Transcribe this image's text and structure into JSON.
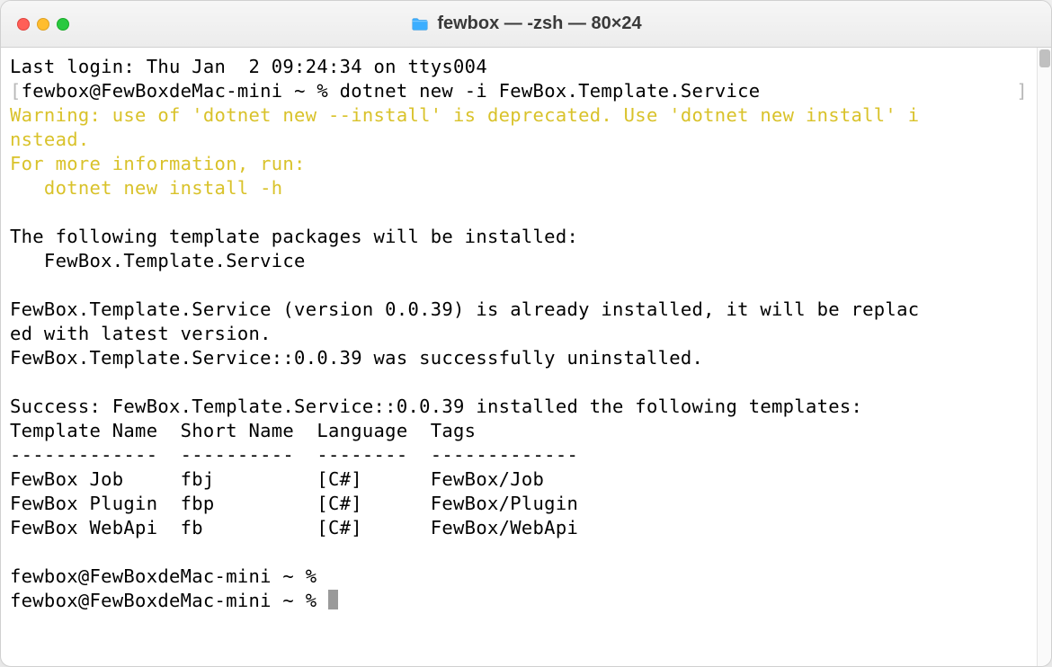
{
  "window": {
    "title": "fewbox — -zsh — 80×24"
  },
  "terminal": {
    "last_login": "Last login: Thu Jan  2 09:24:34 on ttys004",
    "prompt_open": "[",
    "prompt_text": "fewbox@FewBoxdeMac-mini ~ % ",
    "prompt_close": "]",
    "command": "dotnet new -i FewBox.Template.Service",
    "warning_line1": "Warning: use of 'dotnet new --install' is deprecated. Use 'dotnet new install' i",
    "warning_line2": "nstead.",
    "warning_line3": "For more information, run:",
    "warning_line4": "   dotnet new install -h",
    "info_line1": "The following template packages will be installed:",
    "info_line2": "   FewBox.Template.Service",
    "replace_line1": "FewBox.Template.Service (version 0.0.39) is already installed, it will be replac",
    "replace_line2": "ed with latest version.",
    "uninstall_line": "FewBox.Template.Service::0.0.39 was successfully uninstalled.",
    "success_line": "Success: FewBox.Template.Service::0.0.39 installed the following templates:",
    "table": {
      "header": "Template Name  Short Name  Language  Tags",
      "divider": "-------------  ----------  --------  -------------",
      "rows": [
        "FewBox Job     fbj         [C#]      FewBox/Job",
        "FewBox Plugin  fbp         [C#]      FewBox/Plugin",
        "FewBox WebApi  fb          [C#]      FewBox/WebApi"
      ]
    },
    "prompt2": "fewbox@FewBoxdeMac-mini ~ % ",
    "prompt3": "fewbox@FewBoxdeMac-mini ~ % "
  }
}
